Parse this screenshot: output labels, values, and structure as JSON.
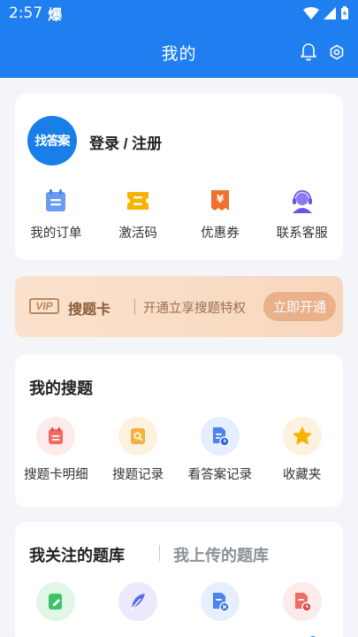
{
  "status_bar": {
    "time": "2:57",
    "extra": "爆"
  },
  "header": {
    "title": "我的"
  },
  "profile": {
    "logo_text": "找答案",
    "login_label": "登录 / 注册"
  },
  "quick_actions": [
    {
      "label": "我的订单",
      "icon": "order-icon"
    },
    {
      "label": "激活码",
      "icon": "ticket-icon"
    },
    {
      "label": "优惠券",
      "icon": "coupon-icon"
    },
    {
      "label": "联系客服",
      "icon": "support-agent-icon"
    }
  ],
  "vip": {
    "badge": "VIP",
    "name": "搜题卡",
    "description": "开通立享搜题特权",
    "button": "立即开通"
  },
  "my_search": {
    "title": "我的搜题",
    "items": [
      {
        "label": "搜题卡明细",
        "icon": "card-detail-icon"
      },
      {
        "label": "搜题记录",
        "icon": "search-record-icon"
      },
      {
        "label": "看答案记录",
        "icon": "answer-record-icon"
      },
      {
        "label": "收藏夹",
        "icon": "star-icon"
      }
    ]
  },
  "question_banks": {
    "tabs": [
      "我关注的题库",
      "我上传的题库"
    ],
    "items": [
      {
        "icon": "edit-doc-icon"
      },
      {
        "icon": "feather-icon"
      },
      {
        "icon": "doc-delete-icon"
      },
      {
        "icon": "doc-time-icon"
      }
    ]
  },
  "colors": {
    "primary": "#1f7ef0",
    "vip_text": "#8a5a3a",
    "vip_button": "#e9b089"
  }
}
